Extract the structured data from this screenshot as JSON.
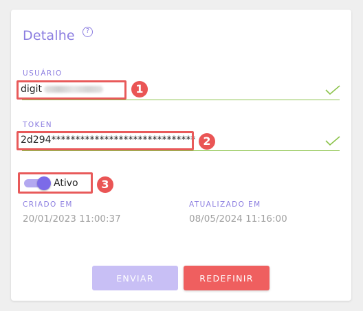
{
  "header": {
    "title": "Detalhe",
    "help_icon": "help-circle-icon",
    "help_glyph": "?"
  },
  "user_field": {
    "label": "USUÁRIO",
    "value": "digit",
    "status_icon": "check-icon"
  },
  "token_field": {
    "label": "TOKEN",
    "value": "2d294******************************",
    "status_icon": "check-icon"
  },
  "active_toggle": {
    "label": "Ativo",
    "checked": true
  },
  "meta": {
    "created_label": "CRIADO EM",
    "created_value": "20/01/2023 11:00:37",
    "updated_label": "ATUALIZADO EM",
    "updated_value": "08/05/2024 11:16:00"
  },
  "actions": {
    "send_label": "ENVIAR",
    "reset_label": "REDEFINIR"
  },
  "annotations": [
    "1",
    "2",
    "3"
  ],
  "colors": {
    "accent": "#8b7de0",
    "valid": "#8bc34a",
    "danger": "#ef5f5f",
    "disabled": "#c8bff5"
  }
}
